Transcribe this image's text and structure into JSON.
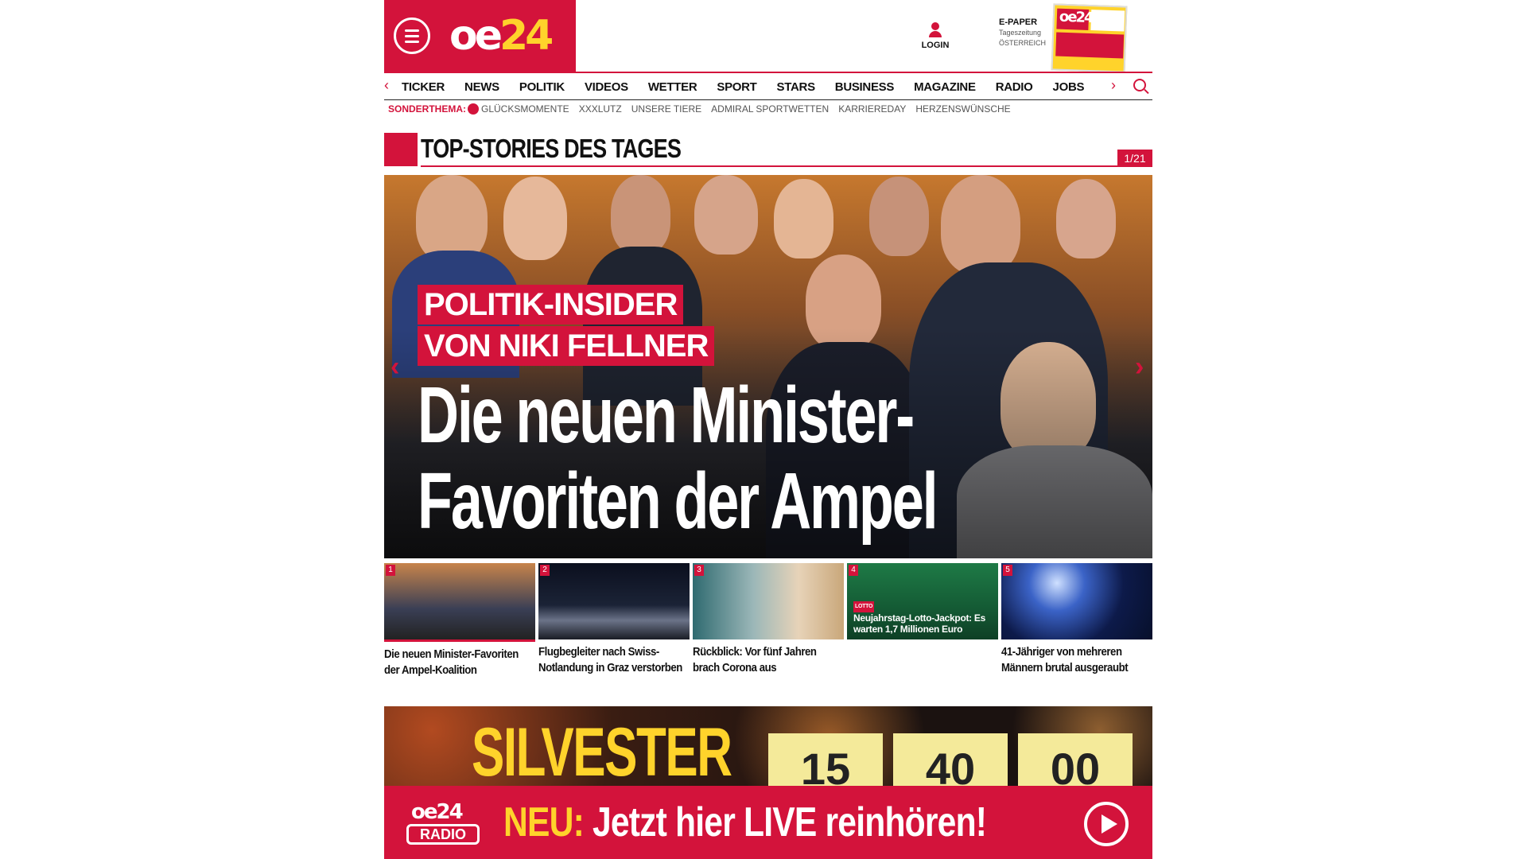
{
  "header": {
    "logo_main": "oe",
    "logo_accent": "24",
    "login_label": "LOGIN",
    "epaper": {
      "title": "E-PAPER",
      "line2": "Tageszeitung",
      "line3": "ÖSTERREICH"
    }
  },
  "nav": {
    "items": [
      "TICKER",
      "NEWS",
      "POLITIK",
      "VIDEOS",
      "WETTER",
      "SPORT",
      "STARS",
      "BUSINESS",
      "MAGAZINE",
      "RADIO",
      "JOBS"
    ]
  },
  "special": {
    "label": "SONDERTHEMA:",
    "items": [
      "GLÜCKSMOMENTE",
      "XXXLUTZ",
      "UNSERE TIERE",
      "ADMIRAL SPORTWETTEN",
      "KARRIEREDAY",
      "HERZENSWÜNSCHE"
    ]
  },
  "section": {
    "title": "TOP-STORIES DES TAGES",
    "counter": "1/21"
  },
  "hero": {
    "kicker_line1": "POLITIK-INSIDER",
    "kicker_line2": "VON NIKI FELLNER",
    "headline_line1": "Die neuen Minister-",
    "headline_line2": "Favoriten der Ampel"
  },
  "teasers": [
    {
      "num": "1",
      "text": "Die neuen Minister-Favoriten der Ampel-Koalition"
    },
    {
      "num": "2",
      "text": "Flugbegleiter nach Swiss-Notlandung in Graz verstorben"
    },
    {
      "num": "3",
      "text": "Rückblick: Vor fünf Jahren brach Corona aus"
    },
    {
      "num": "4",
      "text": "",
      "overlay_tag": "LOTTO",
      "overlay": "Neujahrstag-Lotto-Jackpot: Es warten 1,7 Millionen Euro"
    },
    {
      "num": "5",
      "text": "41-Jähriger von mehreren Männern brutal ausgeraubt"
    }
  ],
  "silvester": {
    "title": "SILVESTER",
    "countdown": [
      "15",
      "40",
      "00"
    ]
  },
  "radio": {
    "logo_top": "oe24",
    "logo_bottom": "RADIO",
    "neu": "NEU:",
    "text": "Jetzt hier LIVE reinhören!"
  },
  "colors": {
    "brand": "#d3133b",
    "accent": "#ffd32b"
  }
}
